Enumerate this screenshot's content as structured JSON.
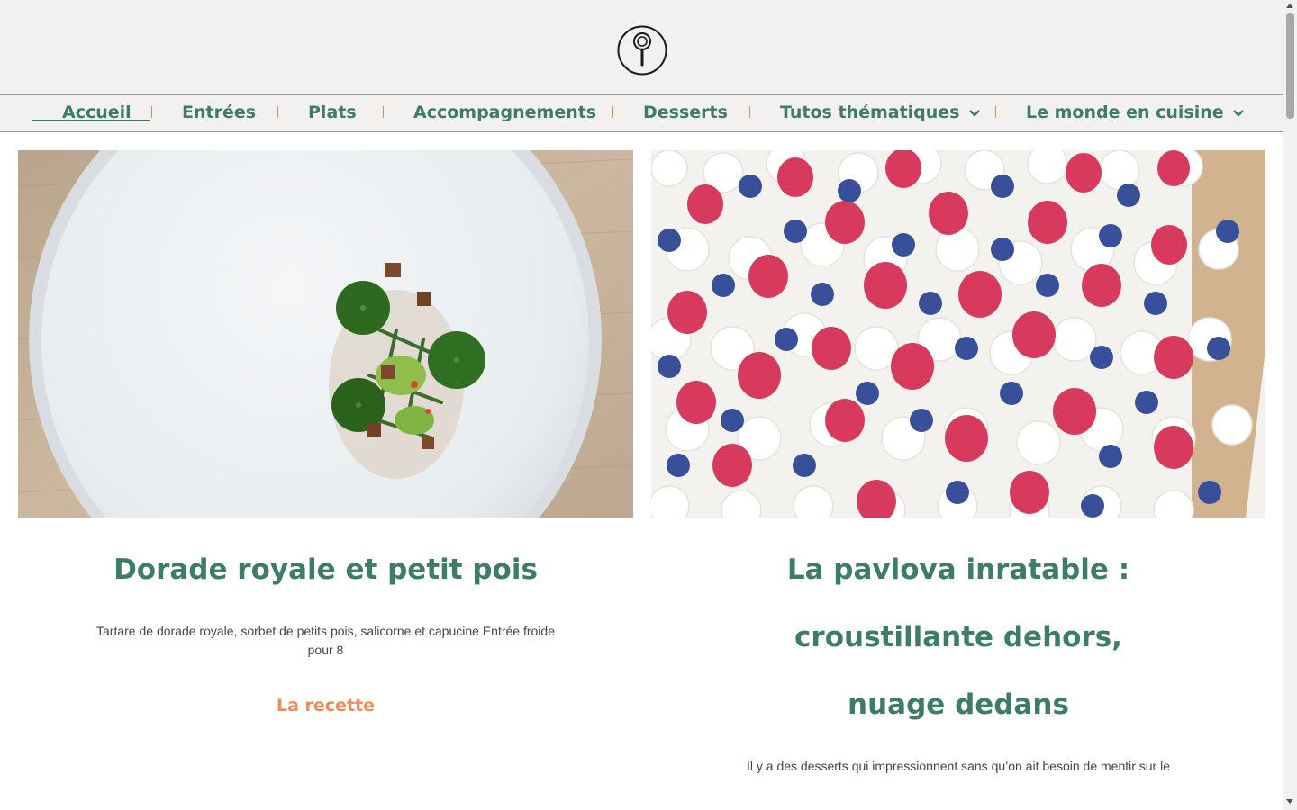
{
  "header": {
    "logo_icon": "frying-pan-spoon-logo",
    "nav": [
      {
        "label": "Accueil",
        "active": true
      },
      {
        "label": "Entrées"
      },
      {
        "label": "Plats"
      },
      {
        "label": "Accompagnements"
      },
      {
        "label": "Desserts"
      },
      {
        "label": "Tutos thématiques",
        "dropdown": true
      },
      {
        "label": "Le monde en cuisine",
        "dropdown": true
      }
    ]
  },
  "cards": [
    {
      "title": "Dorade royale et petit pois",
      "description": "Tartare de dorade royale, sorbet de petits pois, salicorne et capucine Entrée froide pour 8",
      "link_label": "La recette",
      "image": "dorade-plate-photo"
    },
    {
      "title": "La pavlova inratable : croustillante dehors, nuage dedans",
      "description": "Il y a des desserts qui impressionnent sans qu’on ait besoin de mentir sur le",
      "image": "pavlova-berries-photo"
    }
  ],
  "colors": {
    "accent_green": "#3d7d66",
    "accent_orange": "#ef8a55",
    "header_bg": "#f2f1ef"
  }
}
